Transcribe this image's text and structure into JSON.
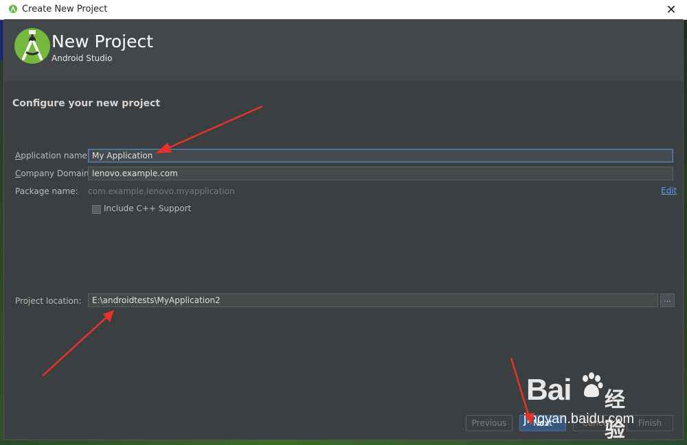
{
  "window": {
    "title": "Create New Project",
    "close_glyph": "✕"
  },
  "header": {
    "title": "New Project",
    "subtitle": "Android Studio"
  },
  "form": {
    "section_title": "Configure your new project",
    "application_name": {
      "label_first": "A",
      "label_rest": "pplication name:",
      "value": "My Application"
    },
    "company_domain": {
      "label_first": "C",
      "label_rest": "ompany Domain:",
      "value": "lenovo.example.com"
    },
    "package_name": {
      "label": "Package name:",
      "value": "com.example.lenovo.myapplication",
      "edit": "Edit"
    },
    "cpp_support": {
      "label": "Include C++ Support",
      "checked": false
    },
    "project_location": {
      "label": "Project location:",
      "value": "E:\\androidtests\\MyApplication2",
      "browse": "..."
    }
  },
  "buttons": {
    "previous": "Previous",
    "next": "Next",
    "cancel": "Cancel",
    "finish": "Finish"
  },
  "watermark": {
    "brand": "Bai",
    "brand_cn": "经验",
    "url": "jingyan.baidu.com"
  },
  "colors": {
    "dialog_bg": "#3c3f41",
    "header_bg": "#444749",
    "accent": "#589df6",
    "annotation_arrow": "#e8332a"
  }
}
